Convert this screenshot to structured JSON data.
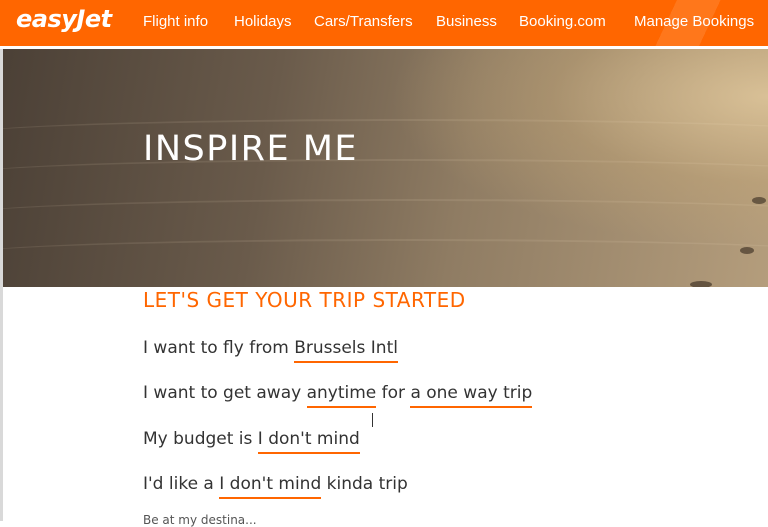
{
  "header": {
    "logo": "easyJet",
    "nav": [
      {
        "label": "Flight info"
      },
      {
        "label": "Holidays"
      },
      {
        "label": "Cars/Transfers"
      },
      {
        "label": "Business"
      },
      {
        "label": "Booking.com"
      },
      {
        "label": "Manage Bookings"
      }
    ]
  },
  "hero": {
    "title": "INSPIRE ME"
  },
  "form": {
    "heading": "LET'S GET YOUR TRIP STARTED",
    "line1": {
      "prefix": "I want to fly from ",
      "origin": "Brussels Intl"
    },
    "line2": {
      "prefix": "I want to get away ",
      "when": "anytime",
      "middle": " for ",
      "trip_type": "a one way trip"
    },
    "line3": {
      "prefix": "My budget is ",
      "budget": "I don't mind"
    },
    "line4": {
      "prefix": "I'd like a ",
      "kind": "I don't mind",
      "suffix": " kinda trip"
    },
    "line5_partial": "Be at my destina..."
  },
  "colors": {
    "brand_orange": "#ff6600",
    "text": "#333333"
  }
}
